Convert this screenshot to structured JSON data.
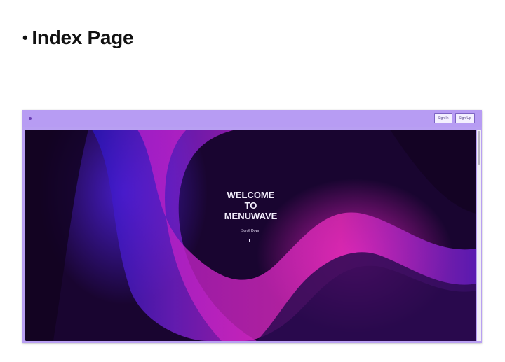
{
  "slide": {
    "bullet": "•",
    "heading": "Index Page"
  },
  "app": {
    "nav": {
      "sign_in": "Sign In",
      "sign_up": "Sign Up"
    },
    "hero": {
      "line1": "WELCOME",
      "line2": "TO",
      "line3": "MENUWAVE",
      "scroll_label": "Scroll Down"
    }
  },
  "colors": {
    "navbar": "#b79cf3",
    "hero_background": "#1a0630",
    "wave_magenta": "#e02bb8",
    "wave_blue": "#3a1fd1",
    "wave_purple": "#8a2be2"
  },
  "icons": {
    "logo": "logo-dot-icon",
    "scroll": "scroll-arrow-icon"
  }
}
